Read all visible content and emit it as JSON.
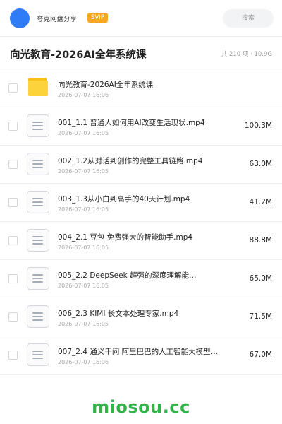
{
  "header": {
    "share_title": "夸克网盘分享",
    "badge": "SVIP",
    "search_placeholder": "搜索",
    "accent_color": "#2f7cf6"
  },
  "folder": {
    "title": "向光教育-2026AI全年系统课",
    "meta": "共 210 项 · 10.9G"
  },
  "files": [
    {
      "icon": "folder-icon",
      "name": "向光教育-2026AI全年系统课",
      "date": "2026-07-07 16:06",
      "size": ""
    },
    {
      "icon": "document-icon",
      "name": "001_1.1 普通人如何用AI改变生活现状.mp4",
      "date": "2026-07-07 16:05",
      "size": "100.3M"
    },
    {
      "icon": "document-icon",
      "name": "002_1.2从对话到创作的完整工具链路.mp4",
      "date": "2026-07-07 16:05",
      "size": "63.0M"
    },
    {
      "icon": "document-icon",
      "name": "003_1.3从小白到高手的40天计划.mp4",
      "date": "2026-07-07 16:05",
      "size": "41.2M"
    },
    {
      "icon": "document-icon",
      "name": "004_2.1 豆包 免费强大的智能助手.mp4",
      "date": "2026-07-07 16:05",
      "size": "88.8M"
    },
    {
      "icon": "document-icon",
      "name": "005_2.2 DeepSeek 超强的深度理解能…",
      "date": "2026-07-07 16:05",
      "size": "65.0M"
    },
    {
      "icon": "document-icon",
      "name": "006_2.3 KIMI 长文本处理专家.mp4",
      "date": "2026-07-07 16:05",
      "size": "71.5M"
    },
    {
      "icon": "document-icon",
      "name": "007_2.4 通义千问 阿里巴巴的人工智能大模型…",
      "date": "2026-07-07 16:06",
      "size": "67.0M"
    }
  ],
  "watermark": "miosou.cc"
}
